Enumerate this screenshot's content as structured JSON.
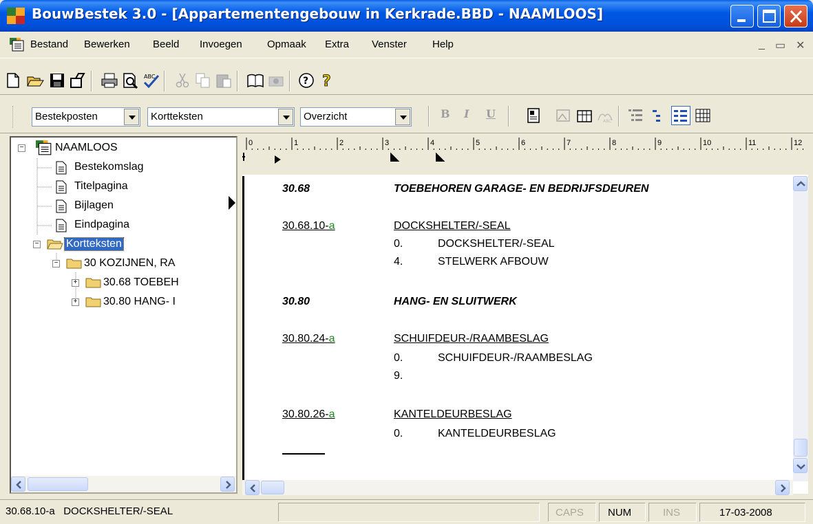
{
  "window": {
    "title": "BouwBestek 3.0 - [Appartementengebouw in Kerkrade.BBD - NAAMLOOS]"
  },
  "menu": {
    "items": [
      "Bestand",
      "Bewerken",
      "Beeld",
      "Invoegen",
      "Opmaak",
      "Extra",
      "Venster",
      "Help"
    ]
  },
  "format_toolbar": {
    "style_combo": "Bestekposten",
    "text_combo": "Kortteksten",
    "view_combo": "Overzicht",
    "bold": "B",
    "italic": "I",
    "underline": "U"
  },
  "tree": {
    "root": "NAAMLOOS",
    "items": [
      "Bestekomslag",
      "Titelpagina",
      "Bijlagen",
      "Eindpagina"
    ],
    "folder": "Kortteksten",
    "chapter": "30 KOZIJNEN, RA",
    "sub1": "30.68 TOEBEH",
    "sub2": "30.80 HANG- I"
  },
  "ruler": {
    "numbers": [
      "0",
      "1",
      "2",
      "3",
      "4",
      "5",
      "6",
      "7",
      "8",
      "9",
      "10",
      "11",
      "12"
    ]
  },
  "document": {
    "sec1_code": "30.68",
    "sec1_title": "TOEBEHOREN GARAGE- EN BEDRIJFSDEUREN",
    "item1_code": "30.68.10-",
    "item1_suffix": "a",
    "item1_title": "DOCKSHELTER/-SEAL",
    "item1_l1_num": "0.",
    "item1_l1_text": "DOCKSHELTER/-SEAL",
    "item1_l2_num": "4.",
    "item1_l2_text": "STELWERK AFBOUW",
    "sec2_code": "30.80",
    "sec2_title": "HANG- EN SLUITWERK",
    "item2_code": "30.80.24-",
    "item2_suffix": "a",
    "item2_title": "SCHUIFDEUR-/RAAMBESLAG",
    "item2_l1_num": "0.",
    "item2_l1_text": "SCHUIFDEUR-/RAAMBESLAG",
    "item2_l2_num": "9.",
    "item3_code": "30.80.26-",
    "item3_suffix": "a",
    "item3_title": "KANTELDEURBESLAG",
    "item3_l1_num": "0.",
    "item3_l1_text": "KANTELDEURBESLAG"
  },
  "status": {
    "message": "30.68.10-a   DOCKSHELTER/-SEAL",
    "caps": "CAPS",
    "num": "NUM",
    "ins": "INS",
    "date": "17-03-2008"
  },
  "colors": {
    "titlebar": "#0058e6",
    "link_suffix": "#1a8a1a",
    "selection": "#316ac5"
  }
}
